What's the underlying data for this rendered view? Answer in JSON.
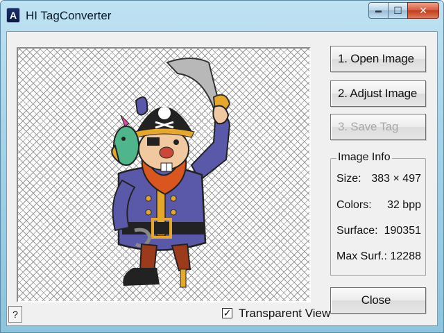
{
  "window": {
    "title": "HI TagConverter",
    "app_icon": "A",
    "caption": {
      "minimize": "▬",
      "maximize": "☐",
      "close": "✕"
    }
  },
  "preview": {
    "image_subject": "pirate-with-parrot-and-sword",
    "background": "transparency-checker-mesh"
  },
  "buttons": {
    "open": "1.  Open Image",
    "adjust": "2.  Adjust Image",
    "save": "3.  Save Tag",
    "close": "Close",
    "help": "?"
  },
  "info": {
    "legend": "Image Info",
    "rows": [
      {
        "key": "Size:",
        "value": "383 × 497"
      },
      {
        "key": "Colors:",
        "value": "32 bpp"
      },
      {
        "key": "Surface:",
        "value": "190351"
      },
      {
        "key": "Max Surf.:",
        "value": "12288"
      }
    ]
  },
  "transparent_view": {
    "label": "Transparent View",
    "checked": true,
    "mark": "✓"
  },
  "colors": {
    "close_button_red": "#c23a1c",
    "pirate_coat": "#5a58a8",
    "pirate_beard": "#d9561e",
    "parrot_green": "#4fb58a"
  }
}
